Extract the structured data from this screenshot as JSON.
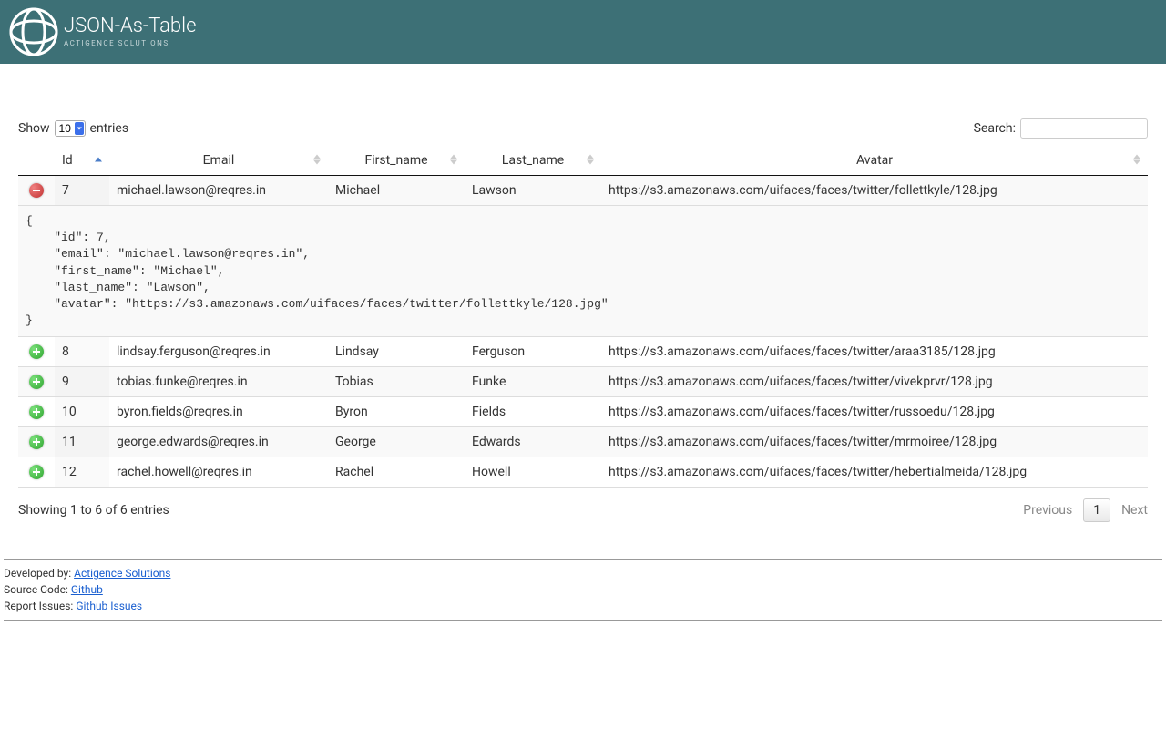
{
  "brand": {
    "title": "JSON-As-Table",
    "subtitle": "ACTIGENCE SOLUTIONS"
  },
  "controls": {
    "show_label": "Show",
    "entries_label": "entries",
    "page_size": "10",
    "search_label": "Search:"
  },
  "columns": {
    "id": "Id",
    "email": "Email",
    "first_name": "First_name",
    "last_name": "Last_name",
    "avatar": "Avatar"
  },
  "rows": [
    {
      "id": "7",
      "email": "michael.lawson@reqres.in",
      "first_name": "Michael",
      "last_name": "Lawson",
      "avatar": "https://s3.amazonaws.com/uifaces/faces/twitter/follettkyle/128.jpg",
      "expanded": true
    },
    {
      "id": "8",
      "email": "lindsay.ferguson@reqres.in",
      "first_name": "Lindsay",
      "last_name": "Ferguson",
      "avatar": "https://s3.amazonaws.com/uifaces/faces/twitter/araa3185/128.jpg",
      "expanded": false
    },
    {
      "id": "9",
      "email": "tobias.funke@reqres.in",
      "first_name": "Tobias",
      "last_name": "Funke",
      "avatar": "https://s3.amazonaws.com/uifaces/faces/twitter/vivekprvr/128.jpg",
      "expanded": false
    },
    {
      "id": "10",
      "email": "byron.fields@reqres.in",
      "first_name": "Byron",
      "last_name": "Fields",
      "avatar": "https://s3.amazonaws.com/uifaces/faces/twitter/russoedu/128.jpg",
      "expanded": false
    },
    {
      "id": "11",
      "email": "george.edwards@reqres.in",
      "first_name": "George",
      "last_name": "Edwards",
      "avatar": "https://s3.amazonaws.com/uifaces/faces/twitter/mrmoiree/128.jpg",
      "expanded": false
    },
    {
      "id": "12",
      "email": "rachel.howell@reqres.in",
      "first_name": "Rachel",
      "last_name": "Howell",
      "avatar": "https://s3.amazonaws.com/uifaces/faces/twitter/hebertialmeida/128.jpg",
      "expanded": false
    }
  ],
  "expanded_json": "{\n    \"id\": 7,\n    \"email\": \"michael.lawson@reqres.in\",\n    \"first_name\": \"Michael\",\n    \"last_name\": \"Lawson\",\n    \"avatar\": \"https://s3.amazonaws.com/uifaces/faces/twitter/follettkyle/128.jpg\"\n}",
  "info": "Showing 1 to 6 of 6 entries",
  "paginate": {
    "prev": "Previous",
    "next": "Next",
    "page": "1"
  },
  "credits": {
    "dev_label": "Developed by: ",
    "dev_link": "Actigence Solutions",
    "src_label": "Source Code: ",
    "src_link": "Github",
    "iss_label": "Report Issues: ",
    "iss_link": "Github Issues"
  }
}
